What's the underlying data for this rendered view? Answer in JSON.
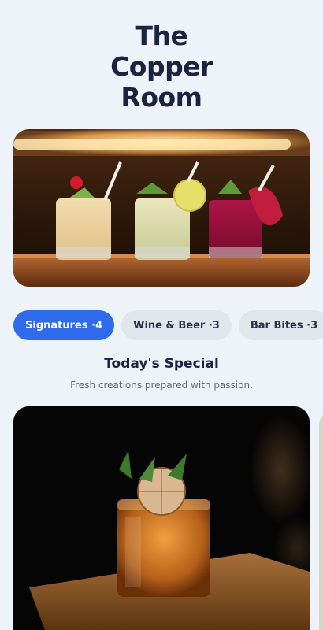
{
  "header": {
    "title_lines": [
      "The",
      "Copper",
      "Room"
    ]
  },
  "tabs": [
    {
      "label": "Signatures",
      "count": "4",
      "active": true
    },
    {
      "label": "Wine & Beer",
      "count": "3",
      "active": false
    },
    {
      "label": "Bar Bites",
      "count": "3",
      "active": false
    }
  ],
  "special": {
    "title": "Today's Special",
    "subtitle": "Fresh creations prepared with passion."
  },
  "colors": {
    "background": "#eef2f9",
    "accent": "#2f6bea",
    "tab_inactive": "#e1e5ec",
    "text": "#1b2340"
  },
  "images": {
    "hero": "three-cocktails-on-bar-photo",
    "special": "whiskey-cocktail-with-garnish-photo"
  }
}
